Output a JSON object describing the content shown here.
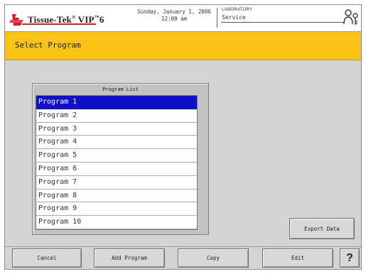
{
  "header": {
    "brand": "Tissue-Tek",
    "brand_reg": "®",
    "brand_model": "VIP",
    "brand_tm": "™",
    "brand_version": "6",
    "date": "Sunday, January 1, 2006",
    "time": "12:00 am",
    "location": "LABORATORY",
    "user": "Service",
    "user_icon": "user-key-icon"
  },
  "title": "Select Program",
  "program_list": {
    "header": "Program List",
    "items": [
      "Program 1",
      "Program 2",
      "Program 3",
      "Program 4",
      "Program 5",
      "Program 6",
      "Program 7",
      "Program 8",
      "Program 9",
      "Program 10"
    ],
    "selected": "Program 1"
  },
  "buttons": {
    "export": "Export Data",
    "cancel": "Cancel",
    "add": "Add Program",
    "copy": "Copy",
    "edit": "Edit",
    "help": "?"
  },
  "colors": {
    "title_bar": "#f9c417",
    "selection": "#1010c8",
    "brand_red": "#d21d2a"
  }
}
